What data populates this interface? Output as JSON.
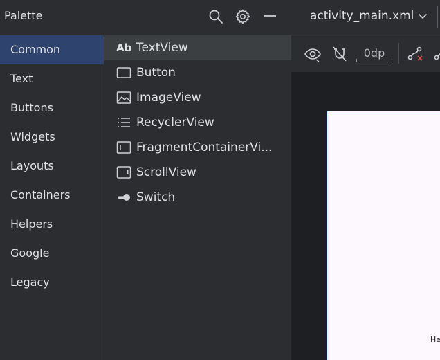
{
  "palette": {
    "title": "Palette",
    "header_icons": [
      "search-icon",
      "gear-icon",
      "minimize-icon"
    ],
    "categories": [
      {
        "label": "Common",
        "selected": true
      },
      {
        "label": "Text",
        "selected": false
      },
      {
        "label": "Buttons",
        "selected": false
      },
      {
        "label": "Widgets",
        "selected": false
      },
      {
        "label": "Layouts",
        "selected": false
      },
      {
        "label": "Containers",
        "selected": false
      },
      {
        "label": "Helpers",
        "selected": false
      },
      {
        "label": "Google",
        "selected": false
      },
      {
        "label": "Legacy",
        "selected": false
      }
    ],
    "widgets": [
      {
        "label": "TextView",
        "icon": "textview-icon",
        "icon_glyph": "Ab",
        "selected": true
      },
      {
        "label": "Button",
        "icon": "button-icon",
        "selected": false
      },
      {
        "label": "ImageView",
        "icon": "image-icon",
        "selected": false
      },
      {
        "label": "RecyclerView",
        "icon": "list-icon",
        "selected": false
      },
      {
        "label": "FragmentContainerVi...",
        "icon": "fragment-container-icon",
        "selected": false
      },
      {
        "label": "ScrollView",
        "icon": "scrollview-icon",
        "selected": false
      },
      {
        "label": "Switch",
        "icon": "switch-icon",
        "selected": false
      }
    ]
  },
  "editor": {
    "tab_label": "activity_main.xml",
    "toolbar": {
      "default_margin": "0dp",
      "icons": [
        "eye-icon",
        "magnet-off-icon",
        "clear-constraints-icon",
        "infer-constraints-icon"
      ]
    },
    "device_preview_text": "He"
  },
  "colors": {
    "background": "#2b2d30",
    "selected_category": "#2e436e",
    "selected_widget": "#3c3f41",
    "canvas": "#1e1f22",
    "device": "#fdf7fe",
    "device_border": "#3f6fd6",
    "text": "#dfe1e5",
    "error_red": "#e05555"
  }
}
